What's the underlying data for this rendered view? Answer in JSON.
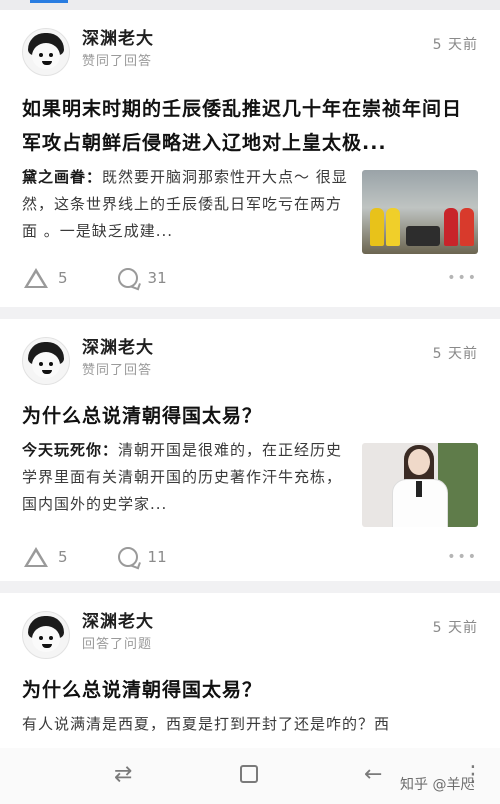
{
  "feed": [
    {
      "user": "深渊老大",
      "action": "赞同了回答",
      "time": "5 天前",
      "title": "如果明末时期的壬辰倭乱推迟几十年在崇祯年间日军攻占朝鲜后侵略进入辽地对上皇太极...",
      "author": "黛之画眷：",
      "excerpt": "既然要开脑洞那索性开大点～ 很显然，这条世界线上的壬辰倭乱日军吃亏在两方面 。一是缺乏成建...",
      "votes": "5",
      "comments": "31",
      "thumb": "history"
    },
    {
      "user": "深渊老大",
      "action": "赞同了回答",
      "time": "5 天前",
      "title": "为什么总说清朝得国太易？",
      "author": "今天玩死你：",
      "excerpt": "清朝开国是很难的，在正经历史学界里面有关清朝开国的历史著作汗牛充栋，国内国外的史学家...",
      "votes": "5",
      "comments": "11",
      "thumb": "portrait"
    },
    {
      "user": "深渊老大",
      "action": "回答了问题",
      "time": "5 天前",
      "title": "为什么总说清朝得国太易？",
      "excerpt": "有人说满清是西夏，西夏是打到开封了还是咋的？西"
    }
  ],
  "more_label": "•••",
  "icons": {
    "vote": "vote-up-icon",
    "comment": "comment-icon",
    "more": "more-icon"
  },
  "navbar": {
    "switch_glyph": "⇄",
    "back_glyph": "←",
    "menu_glyph": "⋮",
    "watermark": "知乎 @羊咫"
  }
}
